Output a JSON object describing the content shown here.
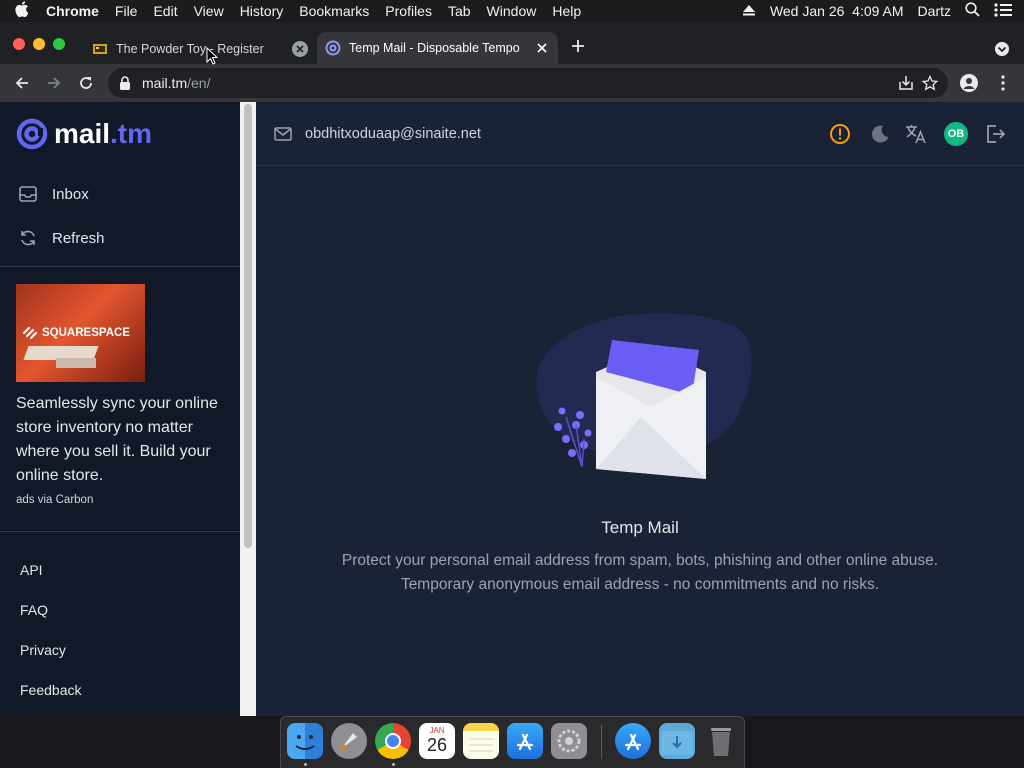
{
  "menubar": {
    "app": "Chrome",
    "items": [
      "File",
      "Edit",
      "View",
      "History",
      "Bookmarks",
      "Profiles",
      "Tab",
      "Window",
      "Help"
    ],
    "datetime": "Wed Jan 26  4:09 AM",
    "user": "Dartz"
  },
  "tabs": [
    {
      "title": "The Powder Toy - Register",
      "active": false
    },
    {
      "title": "Temp Mail - Disposable Tempo",
      "active": true
    }
  ],
  "toolbar": {
    "url_host": "mail.tm",
    "url_path": "/en/"
  },
  "sidebar": {
    "logo_text_1": "mail",
    "logo_text_2": ".tm",
    "nav": [
      {
        "label": "Inbox",
        "icon": "inbox-icon"
      },
      {
        "label": "Refresh",
        "icon": "refresh-icon"
      }
    ],
    "ad": {
      "brand": "SQUARESPACE",
      "text": "Seamlessly sync your online store inventory no matter where you sell it. Build your online store.",
      "via": "ads via Carbon"
    },
    "links": [
      "API",
      "FAQ",
      "Privacy",
      "Feedback"
    ]
  },
  "header": {
    "email": "obdhitxoduaap@sinaite.net",
    "avatar_initials": "OB"
  },
  "empty_state": {
    "title": "Temp Mail",
    "line1": "Protect your personal email address from spam, bots, phishing and other online abuse.",
    "line2": "Temporary anonymous email address - no commitments and no risks."
  },
  "dock": {
    "calendar_month": "JAN",
    "calendar_day": "26"
  },
  "colors": {
    "accent": "#6366f1",
    "warning": "#f59e0b",
    "avatar": "#10b981",
    "page_bg": "#111827"
  }
}
